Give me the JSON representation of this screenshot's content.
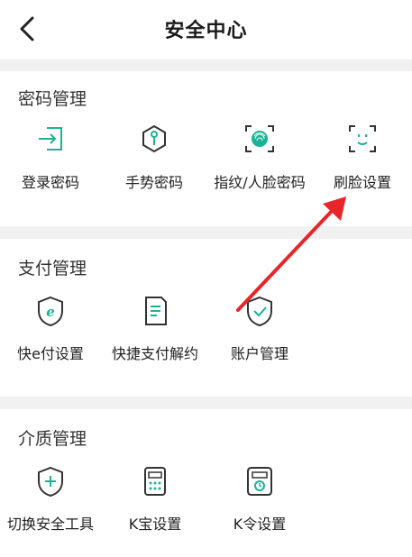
{
  "header": {
    "title": "安全中心",
    "back_icon": "chevron-left-icon"
  },
  "sections": [
    {
      "title": "密码管理",
      "items": [
        {
          "label": "登录密码",
          "icon": "login-icon"
        },
        {
          "label": "手势密码",
          "icon": "gesture-lock-icon"
        },
        {
          "label": "指纹/人脸密码",
          "icon": "fingerprint-icon"
        },
        {
          "label": "刷脸设置",
          "icon": "face-scan-icon"
        }
      ]
    },
    {
      "title": "支付管理",
      "items": [
        {
          "label": "快e付设置",
          "icon": "e-pay-shield-icon"
        },
        {
          "label": "快捷支付解约",
          "icon": "document-icon"
        },
        {
          "label": "账户管理",
          "icon": "shield-check-icon"
        }
      ]
    },
    {
      "title": "介质管理",
      "items": [
        {
          "label": "切换安全工具",
          "icon": "shield-plus-icon"
        },
        {
          "label": "K宝设置",
          "icon": "usb-key-icon"
        },
        {
          "label": "K令设置",
          "icon": "token-device-icon"
        }
      ]
    }
  ],
  "colors": {
    "accent": "#1bb394",
    "arrow": "#e8262a",
    "gap": "#f1f1f1"
  }
}
